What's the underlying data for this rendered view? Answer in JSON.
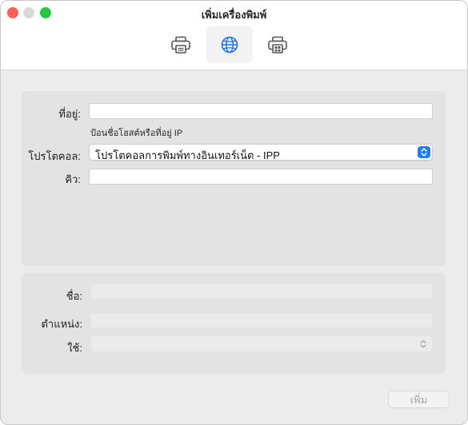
{
  "window": {
    "title": "เพิ่มเครื่องพิมพ์"
  },
  "toolbar": {
    "tabs": [
      {
        "icon": "printer-icon",
        "selected": false
      },
      {
        "icon": "globe-icon",
        "selected": true
      },
      {
        "icon": "windows-printer-icon",
        "selected": false
      }
    ]
  },
  "form": {
    "address_label": "ที่อยู่:",
    "address_value": "",
    "address_hint": "ป้อนชื่อโฮสต์หรือที่อยู่ IP",
    "protocol_label": "โปรโตคอล:",
    "protocol_value": "โปรโตคอลการพิมพ์ทางอินเทอร์เน็ต - IPP",
    "queue_label": "คิว:",
    "queue_value": ""
  },
  "details": {
    "name_label": "ชื่อ:",
    "name_value": "",
    "location_label": "ตำแหน่ง:",
    "location_value": "",
    "use_label": "ใช้:",
    "use_value": ""
  },
  "footer": {
    "add_label": "เพิ่ม"
  },
  "colors": {
    "accent": "#1f7cf6",
    "globe": "#1a73e8"
  }
}
